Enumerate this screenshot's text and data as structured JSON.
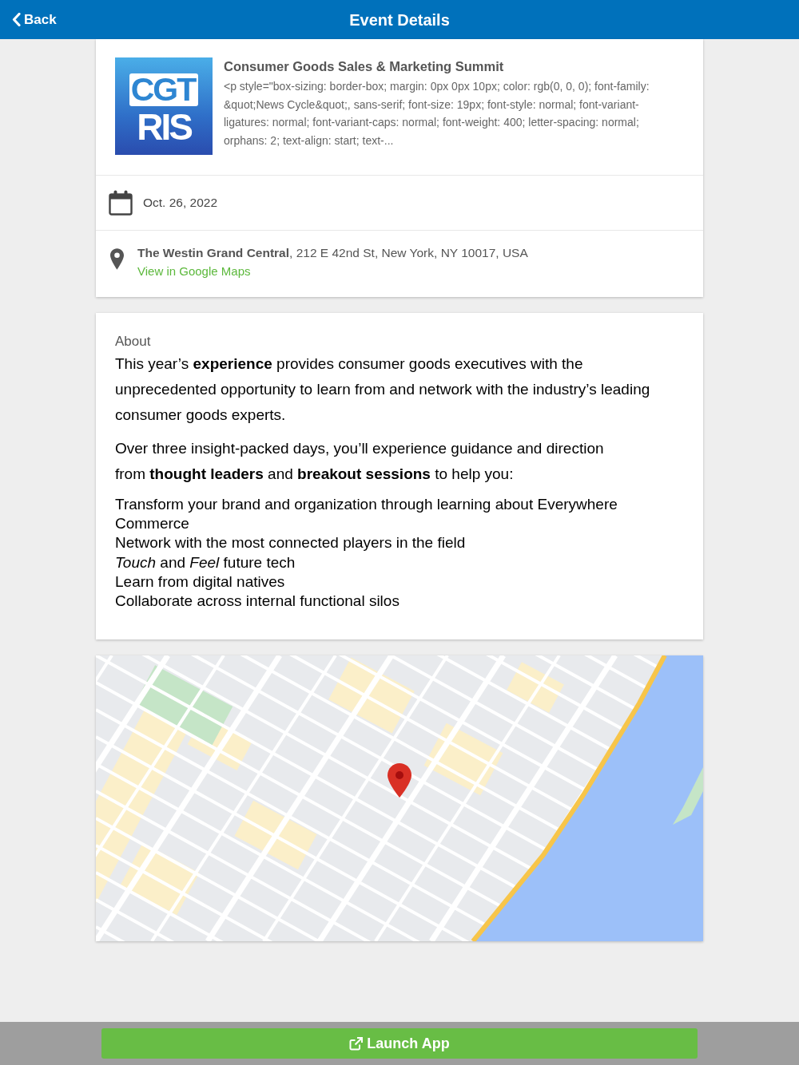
{
  "header": {
    "back_label": "Back",
    "title": "Event Details"
  },
  "event": {
    "logo": {
      "line_1": "CGT",
      "line_2": "RIS"
    },
    "title": "Consumer Goods Sales & Marketing Summit",
    "description": "<p style=\"box-sizing: border-box; margin: 0px 0px 10px; color: rgb(0, 0, 0); font-family: &quot;News Cycle&quot;, sans-serif; font-size: 19px; font-style: normal; font-variant-ligatures: normal; font-variant-caps: normal; font-weight: 400; letter-spacing: normal; orphans: 2; text-align: start; text-...",
    "date": "Oct. 26, 2022",
    "venue": "**The Westin Grand Central**, 212 E 42nd St, New York, NY 10017, USA",
    "map_link": "View in Google Maps"
  },
  "about": {
    "heading": "About",
    "paragraphs": [
      "This year’s **experience** provides consumer goods executives with the unprecedented opportunity to learn from and network with the industry’s leading consumer goods experts.",
      "Over three insight-packed days, you’ll experience guidance and direction\nfrom **thought leaders** and **breakout sessions** to help you:"
    ],
    "list": [
      "Transform your brand and organization through learning about Everywhere Commerce",
      "Network with the most connected players in the field",
      "*Touch* and *Feel* future tech",
      "Learn from digital natives",
      "Collaborate across internal functional silos"
    ]
  },
  "footer": {
    "button": "Launch App"
  }
}
